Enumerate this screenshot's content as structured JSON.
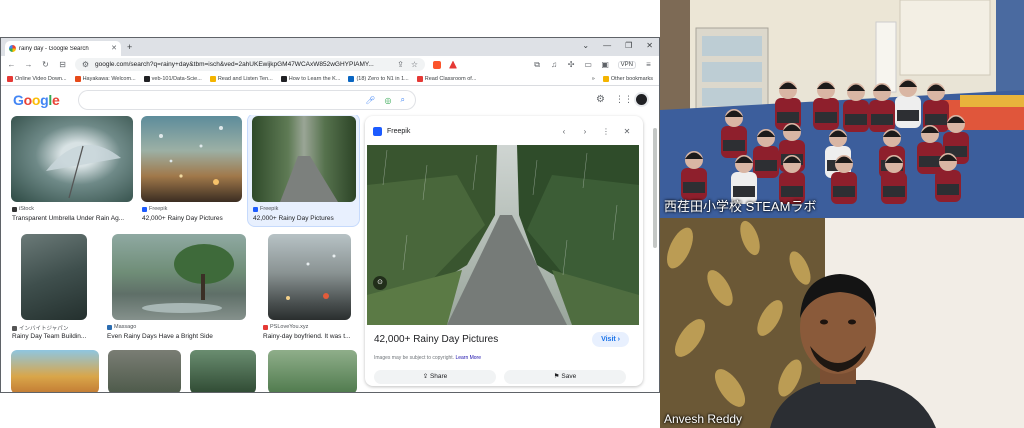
{
  "browser": {
    "tab_title": "rainy day - Google Search",
    "tab_close": "✕",
    "new_tab": "+",
    "window_controls": [
      "⌄",
      "—",
      "❐",
      "✕"
    ],
    "url": "google.com/search?q=rainy+day&tbm=isch&ved=2ahUKEwijkpGM47WCAxW852wGHYPIAMY...",
    "vpn_label": "VPN",
    "bookmarks": [
      {
        "label": "Online Video Down...",
        "color": "#e53935"
      },
      {
        "label": "Hayakawa: Welcom...",
        "color": "#e64a19"
      },
      {
        "label": "veb-101/Data-Scie...",
        "color": "#202124"
      },
      {
        "label": "Read and Listen Ten...",
        "color": "#f4b400"
      },
      {
        "label": "How to Learn the K...",
        "color": "#202124"
      },
      {
        "label": "(18) Zero to N1 in 1...",
        "color": "#0a66c2"
      },
      {
        "label": "Read Classroom of...",
        "color": "#e53935"
      }
    ],
    "other_bookmarks": "Other bookmarks"
  },
  "google": {
    "logo_letters": [
      {
        "ch": "G",
        "color": "#4285f4"
      },
      {
        "ch": "o",
        "color": "#ea4335"
      },
      {
        "ch": "o",
        "color": "#fbbc05"
      },
      {
        "ch": "g",
        "color": "#4285f4"
      },
      {
        "ch": "l",
        "color": "#34a853"
      },
      {
        "ch": "e",
        "color": "#ea4335"
      }
    ],
    "results": [
      {
        "source": "iStock",
        "title": "Transparent Umbrella Under Rain Ag..."
      },
      {
        "source": "Freepik",
        "title": "42,000+ Rainy Day Pictures"
      },
      {
        "source": "Freepik",
        "title": "42,000+ Rainy Day Pictures"
      },
      {
        "source": "インバイトジャパン",
        "title": "Rainy Day Team Buildin..."
      },
      {
        "source": "Massago",
        "title": "Even Rainy Days Have a Bright Side"
      },
      {
        "source": "PSLoveYou.xyz",
        "title": "Rainy-day boyfriend. It was t..."
      }
    ],
    "preview": {
      "site": "Freepik",
      "title": "42,000+ Rainy Day Pictures",
      "visit": "Visit",
      "copyright": "Images may be subject to copyright.",
      "learn_more": "Learn More",
      "share": "Share",
      "save": "Save"
    }
  },
  "video": {
    "tile1_label": "西荏田小学校 STEAMラボ",
    "tile2_label": "Anvesh Reddy"
  },
  "colors": {
    "accent": "#1a73e8",
    "selected_card": "#e8f0fe"
  }
}
